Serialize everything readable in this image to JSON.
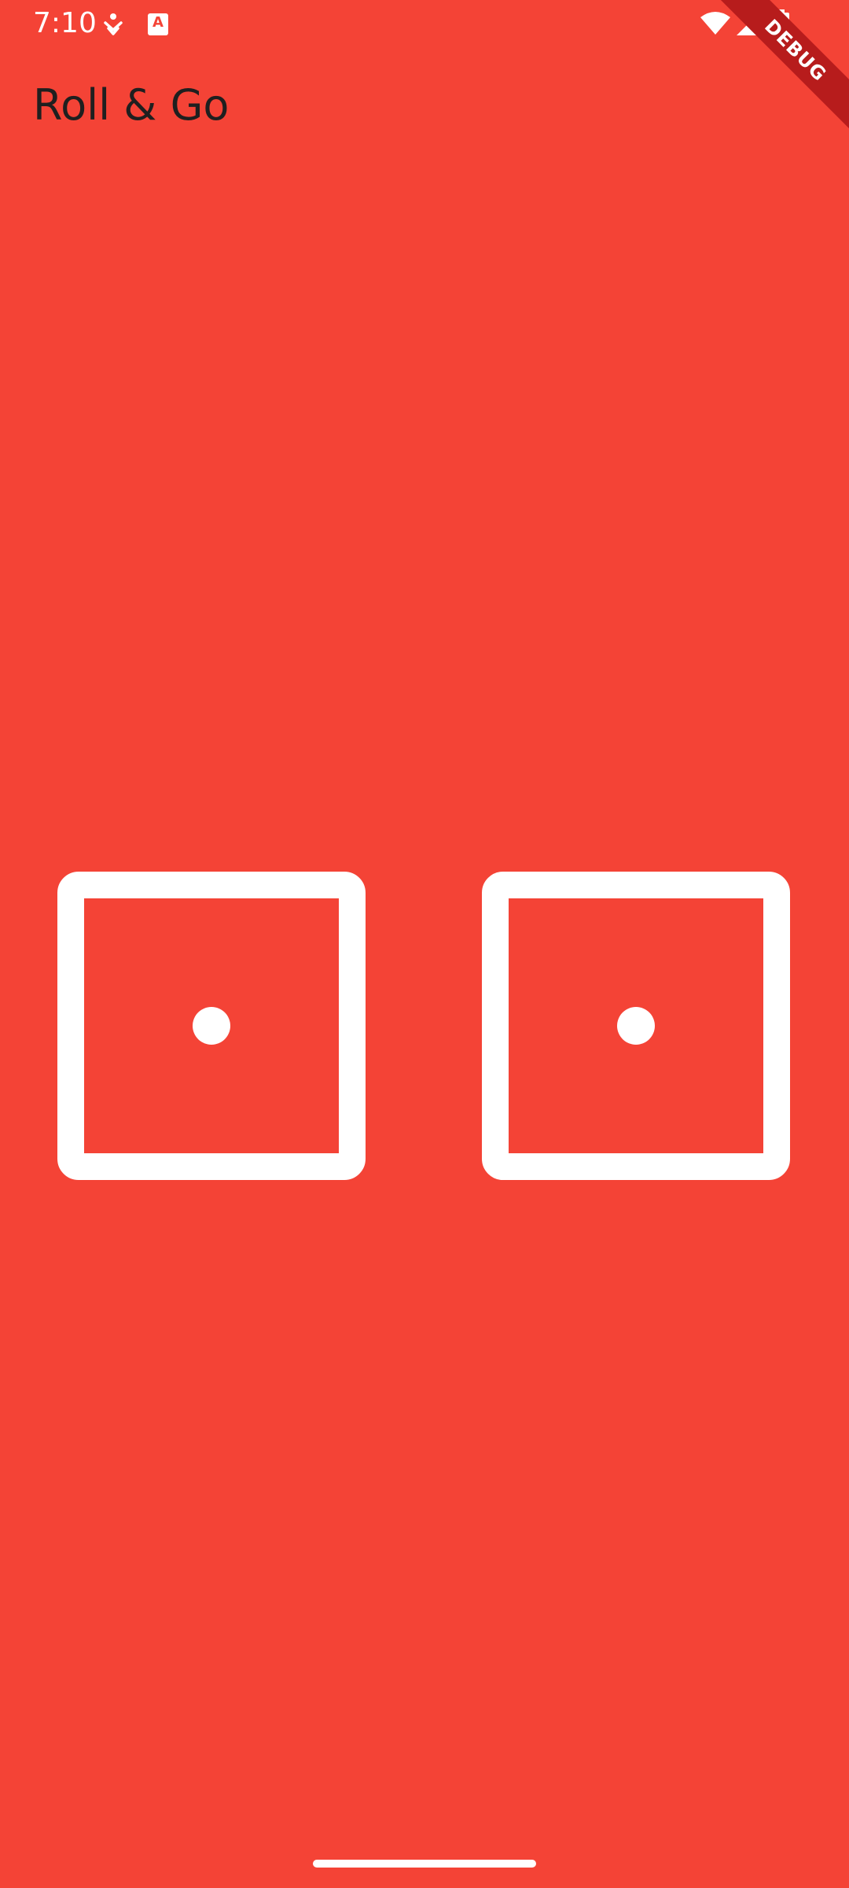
{
  "status_bar": {
    "time": "7:10",
    "notification_icons": [
      "activity-tracker-icon",
      "a-badge-icon"
    ],
    "a_badge_letter": "A",
    "system_icons": [
      "wifi-icon",
      "cell-signal-icon",
      "battery-icon"
    ]
  },
  "debug_banner": {
    "label": "DEBUG",
    "color": "#b71c1c"
  },
  "app_bar": {
    "title": "Roll & Go"
  },
  "dice": [
    {
      "name": "left-die",
      "value": 1
    },
    {
      "name": "right-die",
      "value": 1
    }
  ],
  "colors": {
    "background": "#f44336",
    "foreground": "#ffffff",
    "title": "#1f1f1f"
  }
}
